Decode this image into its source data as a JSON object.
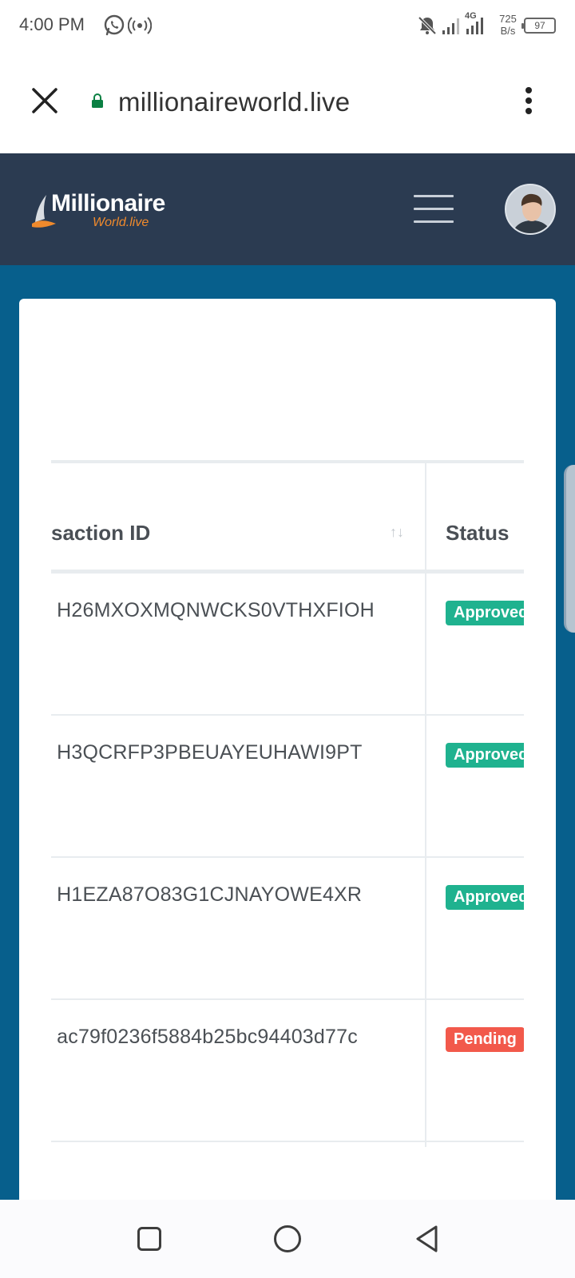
{
  "status_bar": {
    "time": "4:00 PM",
    "network_type": "4G",
    "speed_value": "725",
    "speed_unit": "B/s",
    "battery": "97",
    "icons": [
      "whatsapp-icon",
      "hotspot-icon",
      "mute-icon",
      "signal-icon",
      "signal-icon"
    ]
  },
  "browser": {
    "url": "millionaireworld.live",
    "close_icon": "close-icon",
    "lock_icon": "lock-icon",
    "menu_icon": "more-vert-icon"
  },
  "header": {
    "logo_line1": "Millionaire",
    "logo_line2": "World.live",
    "menu_icon": "hamburger-icon",
    "colors": {
      "header_bg": "#2b3b51",
      "page_bg": "#075f8c",
      "logo_accent": "#f08a2c"
    }
  },
  "table": {
    "columns": [
      {
        "label": "saction ID",
        "sort_icon": "sort-icon"
      },
      {
        "label": "Status"
      }
    ],
    "sort_glyph": "↑↓",
    "rows": [
      {
        "transaction_id": " H26MXOXMQNWCKS0VTHXFIOH",
        "status": "Approved"
      },
      {
        "transaction_id": " H3QCRFP3PBEUAYEUHAWI9PT",
        "status": "Approved"
      },
      {
        "transaction_id": " H1EZA87O83G1CJNAYOWE4XR",
        "status": "Approved"
      },
      {
        "transaction_id": " ac79f0236f5884b25bc94403d77c",
        "status": "Pending"
      }
    ],
    "colors": {
      "approved": "#1fb28f",
      "pending": "#f2594b"
    }
  },
  "nav_bar": {
    "icons": [
      "recent-apps-icon",
      "home-icon",
      "back-icon"
    ]
  }
}
